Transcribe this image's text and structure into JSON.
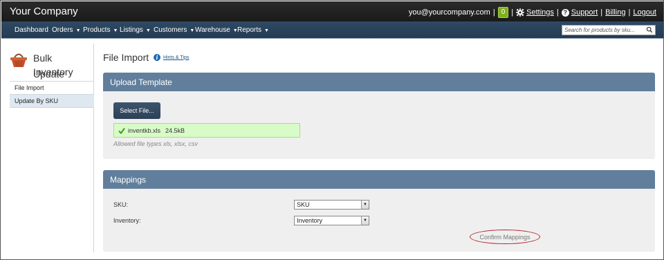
{
  "header": {
    "company": "Your Company",
    "email": "you@yourcompany.com",
    "notification_count": "0",
    "settings_label": "Settings",
    "support_label": "Support",
    "billing_label": "Billing",
    "logout_label": "Logout",
    "separator": "|"
  },
  "nav": {
    "items": [
      "Dashboard",
      "Orders",
      "Products",
      "Listings",
      "Customers",
      "Warehouse",
      "Reports"
    ],
    "caret": "▼",
    "search_placeholder": "Search for products by sku..."
  },
  "sidebar": {
    "title_line1": "Bulk Inventory",
    "title_line2": "Update",
    "items": [
      "File Import",
      "Update By SKU"
    ]
  },
  "page": {
    "title": "File Import",
    "hints_label": "Hints & Tips"
  },
  "upload": {
    "heading": "Upload Template",
    "select_button": "Select File...",
    "file_name": "inventkb.xls",
    "file_size": "24.5kB",
    "allowed_text": "Allowed file types xls, xlsx, csv"
  },
  "mappings": {
    "heading": "Mappings",
    "sku_label": "SKU:",
    "sku_value": "SKU",
    "inventory_label": "Inventory:",
    "inventory_value": "Inventory",
    "confirm_label": "Confirm Mappings"
  },
  "colors": {
    "topbar": "#1f1f1f",
    "navbar": "#2a435b",
    "panel_header": "#617f9c",
    "success_bg": "#d8fbc8",
    "badge": "#7fb11d",
    "highlight_ring": "#b22222"
  }
}
